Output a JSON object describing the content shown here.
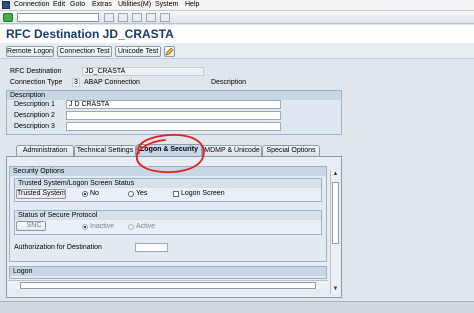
{
  "menu": [
    "Connection",
    "Edit",
    "Goto",
    "Extras",
    "Utilities(M)",
    "System",
    "Help"
  ],
  "window_title": "RFC Destination JD_CRASTA",
  "toolbar": {
    "remote_logon": "Remote Logon",
    "connection_test": "Connection Test",
    "unicode_test": "Unicode Test",
    "edit_icon": "pencil-icon"
  },
  "header": {
    "rfc_destination_label": "RFC Destination",
    "rfc_destination_value": "JD_CRASTA",
    "connection_type_label": "Connection Type",
    "connection_type_code": "3",
    "connection_type_text": "ABAP Connection",
    "description_label": "Description"
  },
  "description_group": {
    "title": "Description",
    "d1_label": "Description 1",
    "d1_value": "J D CRASTA",
    "d2_label": "Description 2",
    "d2_value": "",
    "d3_label": "Description 3",
    "d3_value": ""
  },
  "tabs": [
    "Administration",
    "Technical Settings",
    "Logon & Security",
    "MDMP & Unicode",
    "Special Options"
  ],
  "active_tab": "Logon & Security",
  "security": {
    "section_title": "Security Options",
    "trusted_group_title": "Trusted System/Logon Screen Status",
    "trusted_system_label": "Trusted System",
    "no_label": "No",
    "yes_label": "Yes",
    "logon_screen_label": "Logon Screen",
    "trusted_selected": "No",
    "secure_group_title": "Status of Secure Protocol",
    "snc_label": "SNC",
    "inactive_label": "Inactive",
    "active_label": "Active",
    "auth_label": "Authorization for Destination",
    "auth_value": ""
  },
  "logon_section_title": "Logon",
  "colors": {
    "accent": "#1a3a6b",
    "annotation": "#e02020"
  }
}
